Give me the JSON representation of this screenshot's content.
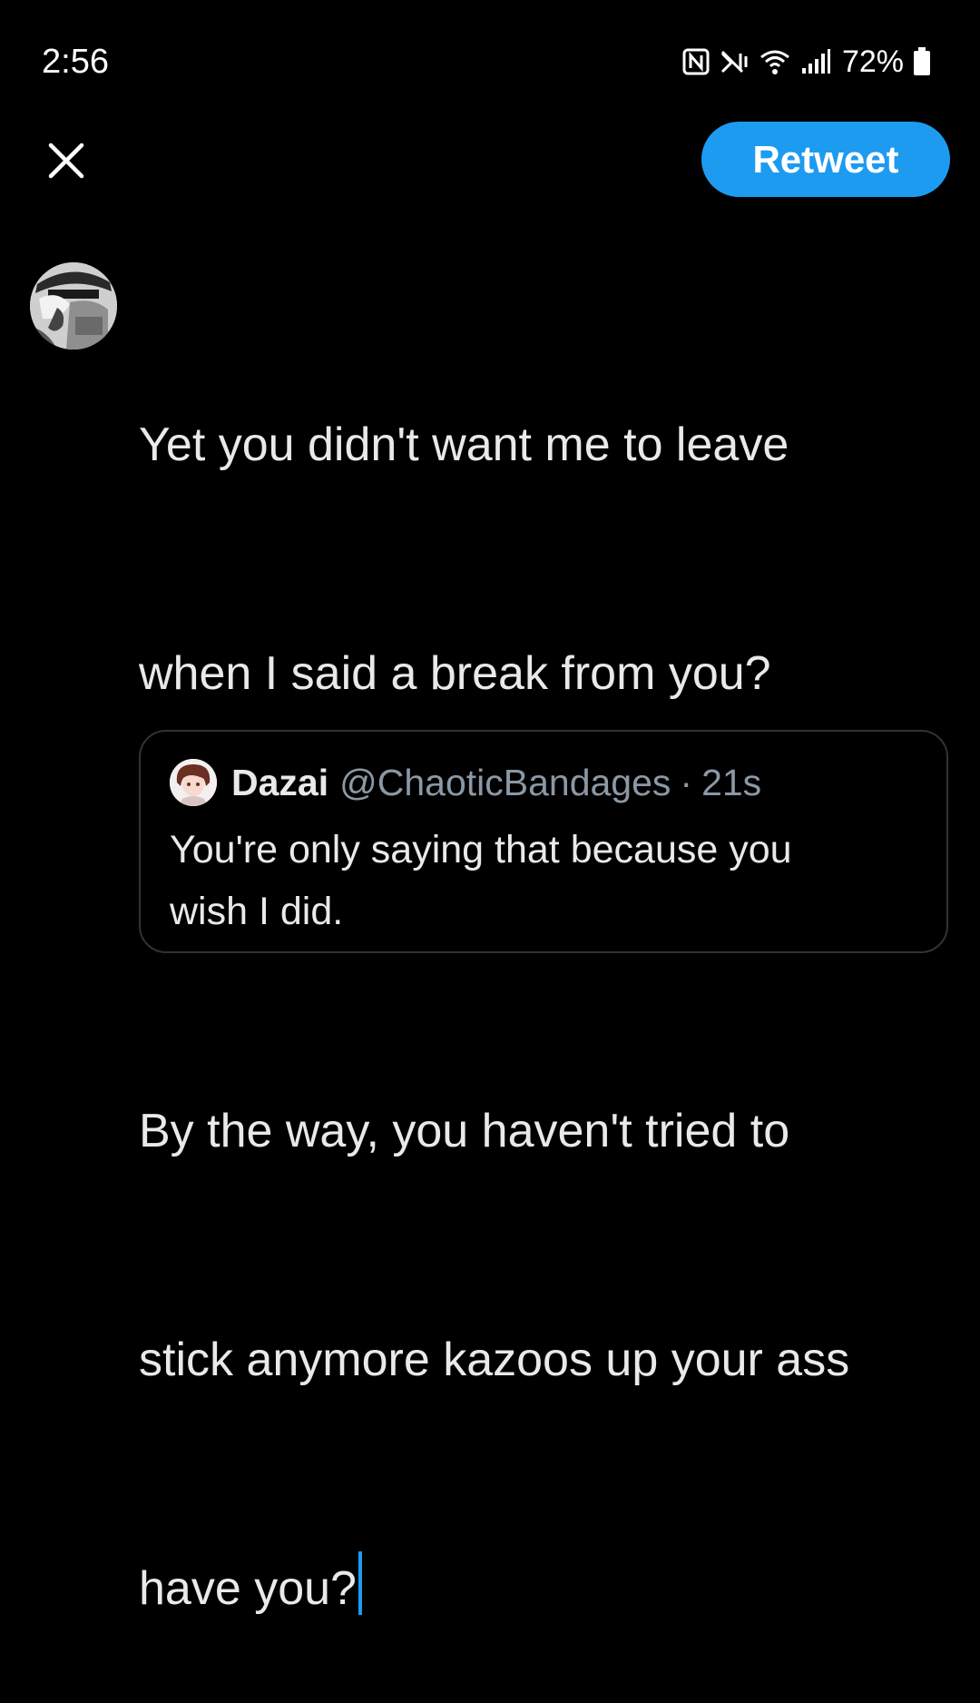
{
  "status_bar": {
    "time": "2:56",
    "battery": "72%",
    "icons": [
      "nfc-icon",
      "vibrate-mute-icon",
      "wifi-icon",
      "cell-signal-icon",
      "battery-icon"
    ]
  },
  "compose": {
    "close_icon": "close-icon",
    "retweet_label": "Retweet",
    "accent_color": "#1d9bf0",
    "text_lines": [
      "Yet you didn't want me to leave",
      "when I said a break from you?",
      "",
      "By the way, you haven't tried to",
      "stick anymore kazoos up your ass",
      "have you?"
    ]
  },
  "quote": {
    "name": "Dazai",
    "handle": "@ChaoticBandages",
    "separator": "·",
    "time": "21s",
    "text_lines": [
      "You're only saying that because you",
      "wish I did."
    ]
  }
}
